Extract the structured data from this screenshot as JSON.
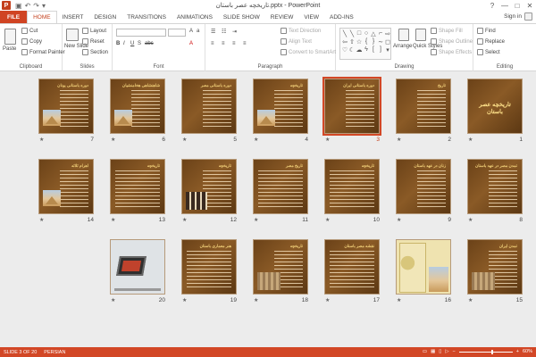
{
  "window": {
    "title": "تاریخچه عصر باستان.pptx - PowerPoint",
    "app_icon_label": "P",
    "controls": [
      "?",
      "—",
      "□",
      "✕"
    ]
  },
  "quick_access": [
    "save-icon",
    "undo-icon",
    "redo-icon",
    "customize-icon"
  ],
  "tabs": [
    {
      "label": "FILE"
    },
    {
      "label": "HOME"
    },
    {
      "label": "INSERT"
    },
    {
      "label": "DESIGN"
    },
    {
      "label": "TRANSITIONS"
    },
    {
      "label": "ANIMATIONS"
    },
    {
      "label": "SLIDE SHOW"
    },
    {
      "label": "REVIEW"
    },
    {
      "label": "VIEW"
    },
    {
      "label": "ADD-INS"
    }
  ],
  "active_tab": "HOME",
  "signin": "Sign in",
  "ribbon": {
    "clipboard": {
      "label": "Clipboard",
      "paste": "Paste",
      "cut": "Cut",
      "copy": "Copy",
      "format_painter": "Format Painter"
    },
    "slides": {
      "label": "Slides",
      "new_slide": "New Slide",
      "layout": "Layout",
      "reset": "Reset",
      "section": "Section"
    },
    "font": {
      "label": "Font"
    },
    "paragraph": {
      "label": "Paragraph",
      "text_direction": "Text Direction",
      "align_text": "Align Text",
      "convert_smartart": "Convert to SmartArt"
    },
    "drawing": {
      "label": "Drawing",
      "arrange": "Arrange",
      "quick_styles": "Quick Styles",
      "shape_fill": "Shape Fill",
      "shape_outline": "Shape Outline",
      "shape_effects": "Shape Effects"
    },
    "editing": {
      "label": "Editing",
      "find": "Find",
      "replace": "Replace",
      "select": "Select"
    }
  },
  "slides": [
    {
      "num": "1",
      "title": "تاریخچه عصر باستان",
      "kind": "bigtitle"
    },
    {
      "num": "2",
      "title": "تاریخ",
      "kind": "text"
    },
    {
      "num": "3",
      "title": "دوره باستانی ایران",
      "kind": "text",
      "selected": true
    },
    {
      "num": "4",
      "title": "تاریخچه",
      "kind": "pic"
    },
    {
      "num": "5",
      "title": "دوره باستانی مصر",
      "kind": "text"
    },
    {
      "num": "6",
      "title": "شاهنشاهی هخامنشیان",
      "kind": "pic"
    },
    {
      "num": "7",
      "title": "دوره باستانی یونان",
      "kind": "pic"
    },
    {
      "num": "8",
      "title": "تمدن مصر در عهد باستان",
      "kind": "text"
    },
    {
      "num": "9",
      "title": "زنان در عهد باستان",
      "kind": "text"
    },
    {
      "num": "10",
      "title": "تاریخچه",
      "kind": "full"
    },
    {
      "num": "11",
      "title": "تاریخ مصر",
      "kind": "full"
    },
    {
      "num": "12",
      "title": "تاریخچه",
      "kind": "bottles"
    },
    {
      "num": "13",
      "title": "تاریخچه",
      "kind": "full"
    },
    {
      "num": "14",
      "title": "اهرام ثلاثه",
      "kind": "pic"
    },
    {
      "num": "15",
      "title": "تمدن ایران",
      "kind": "mixed"
    },
    {
      "num": "16",
      "title": "",
      "kind": "map"
    },
    {
      "num": "17",
      "title": "نقشه مصر باستان",
      "kind": "full"
    },
    {
      "num": "18",
      "title": "تاریخچه",
      "kind": "mixed"
    },
    {
      "num": "19",
      "title": "هنر معماری باستان",
      "kind": "full"
    },
    {
      "num": "20",
      "title": "",
      "kind": "laptop"
    }
  ],
  "status": {
    "slide_info": "SLIDE 3 OF 20",
    "language": "PERSIAN",
    "zoom": "60%",
    "zoom_fraction": 0.6
  },
  "colors": {
    "accent": "#d24726",
    "slide_bg": "#7a4c1e",
    "title_gold": "#f3d27a"
  }
}
